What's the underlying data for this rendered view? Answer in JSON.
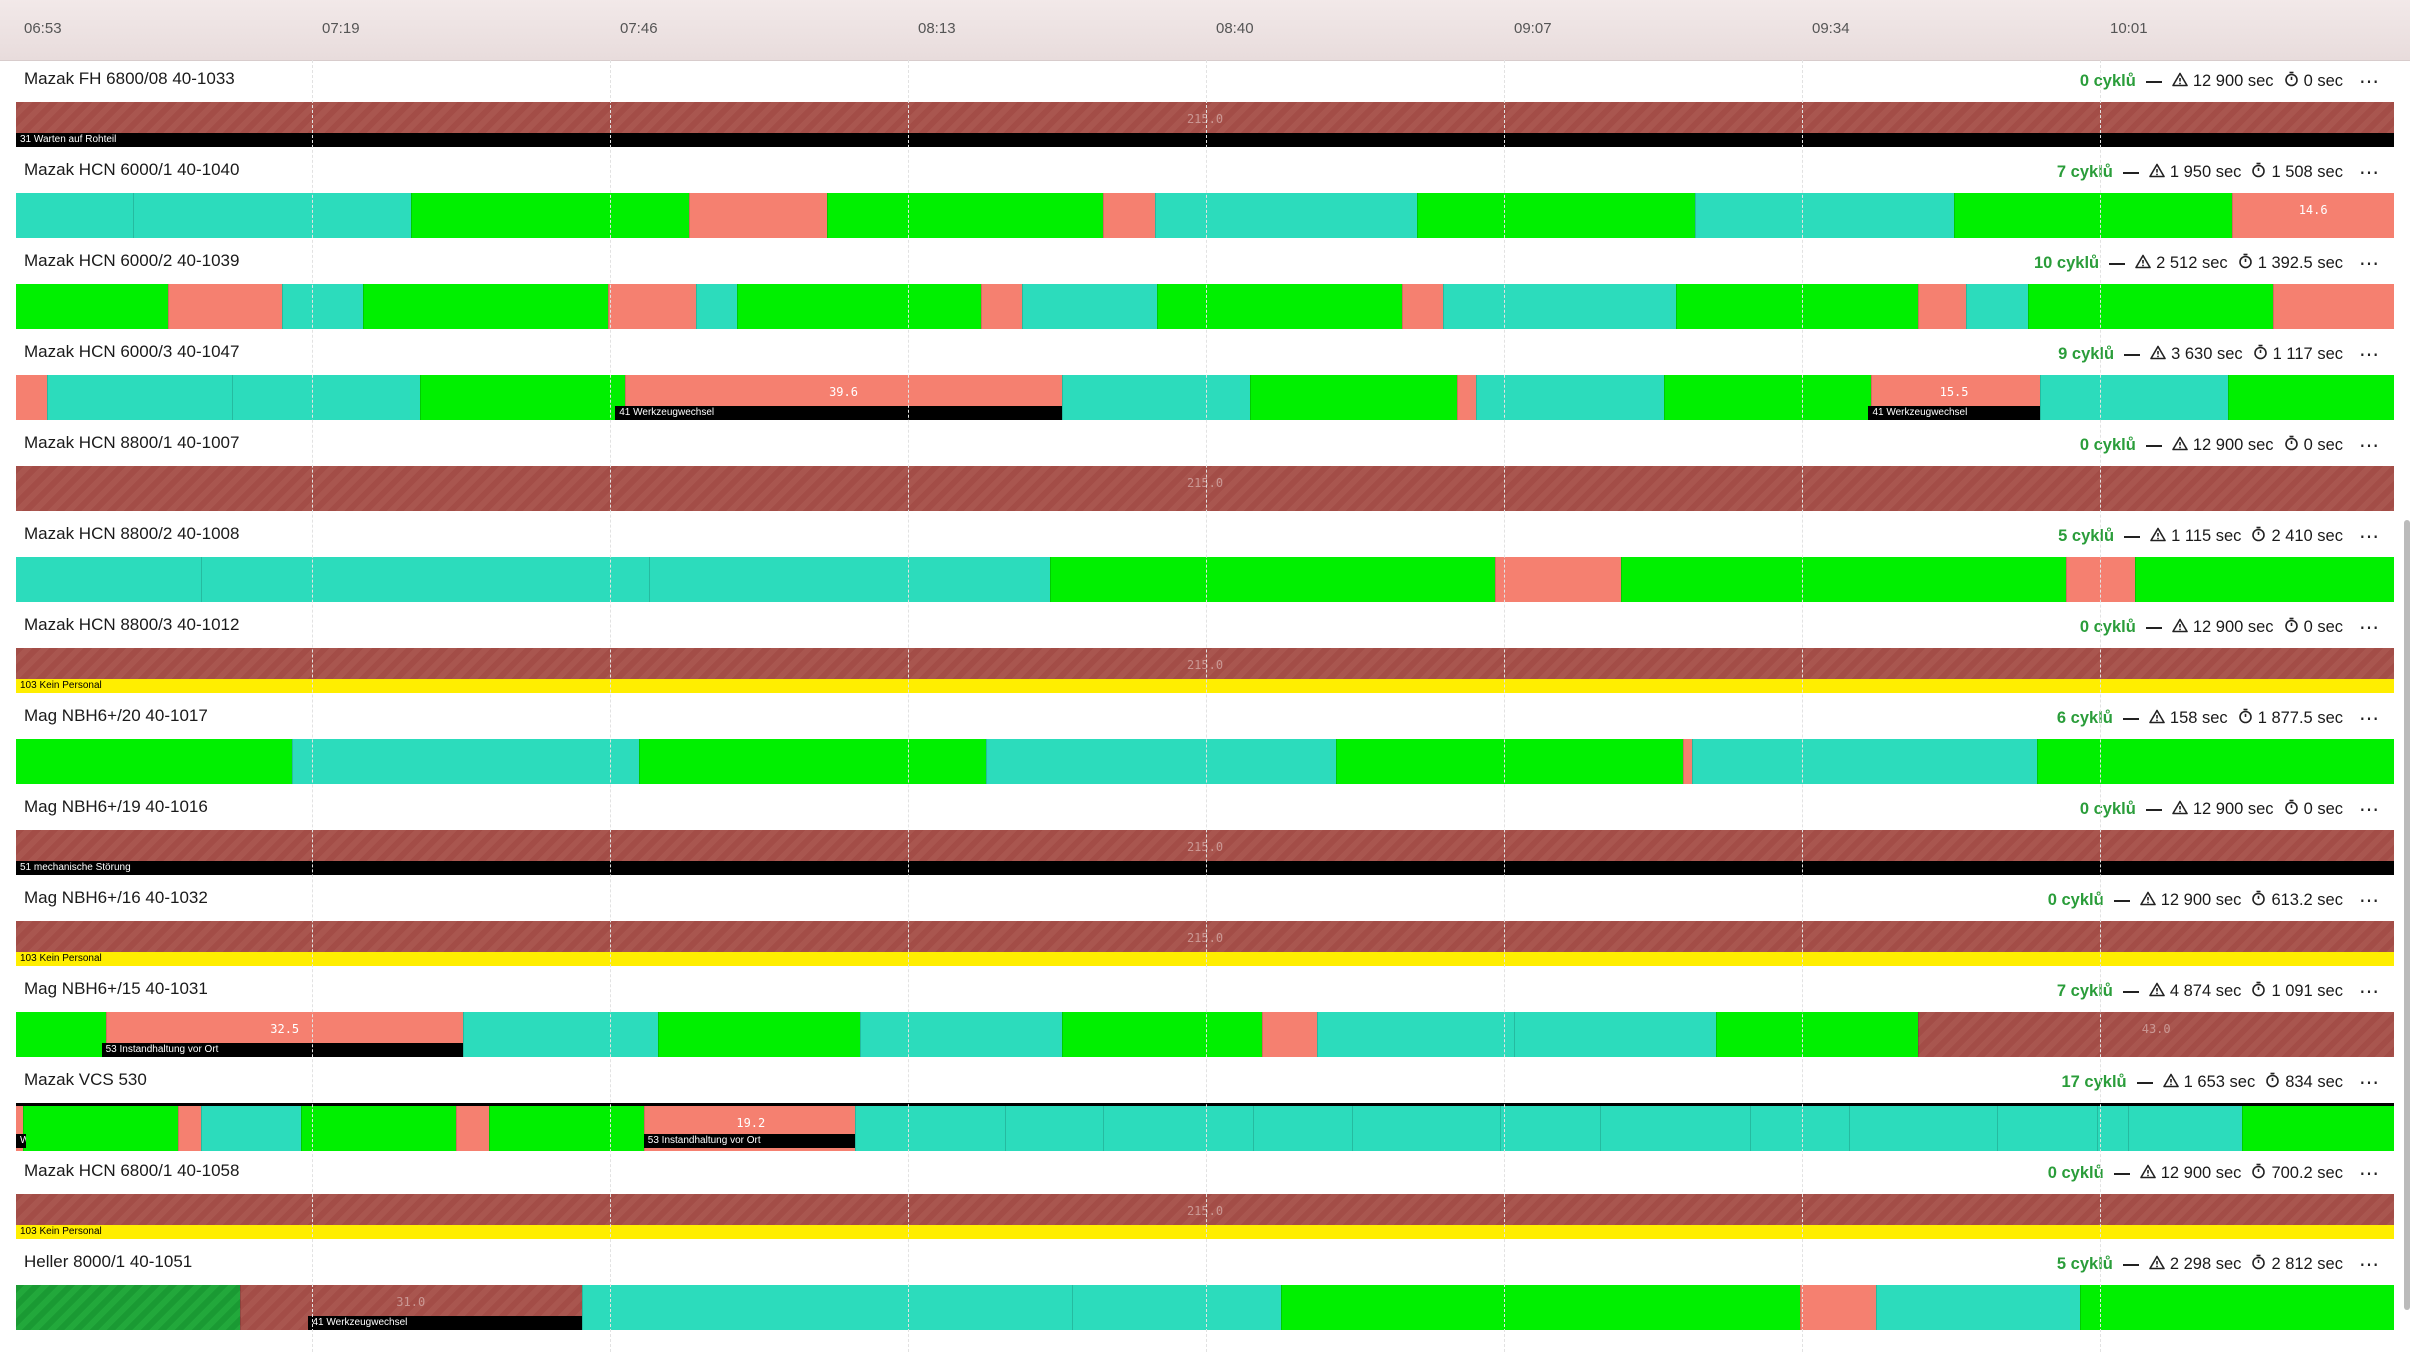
{
  "timeline": {
    "ticks": [
      "06:53",
      "07:19",
      "07:46",
      "08:13",
      "08:40",
      "09:07",
      "09:34",
      "10:01"
    ]
  },
  "rows": [
    {
      "title": "Mazak FH 6800/08 40-1033",
      "cycles": "0 cyklů",
      "warn": "12 900 sec",
      "time": "0 sec",
      "segments": [
        {
          "c": "brown",
          "s": 0,
          "e": 1
        }
      ],
      "values": [
        {
          "t": "215.0",
          "p": 0.5,
          "faint": true
        }
      ],
      "annotations": [
        {
          "t": "31 Warten auf Rohteil",
          "s": 0,
          "e": 1,
          "c": "black"
        }
      ]
    },
    {
      "title": "Mazak HCN 6000/1 40-1040",
      "cycles": "7 cyklů",
      "warn": "1 950 sec",
      "time": "1 508 sec",
      "segments": [
        {
          "c": "teal",
          "s": 0,
          "e": 0.049
        },
        {
          "c": "teal",
          "s": 0.049,
          "e": 0.166
        },
        {
          "c": "green",
          "s": 0.166,
          "e": 0.283
        },
        {
          "c": "salmon",
          "s": 0.283,
          "e": 0.341
        },
        {
          "c": "green",
          "s": 0.341,
          "e": 0.457
        },
        {
          "c": "salmon",
          "s": 0.457,
          "e": 0.479
        },
        {
          "c": "teal",
          "s": 0.479,
          "e": 0.589
        },
        {
          "c": "green",
          "s": 0.589,
          "e": 0.706
        },
        {
          "c": "teal",
          "s": 0.706,
          "e": 0.815
        },
        {
          "c": "green",
          "s": 0.815,
          "e": 0.932
        },
        {
          "c": "salmon",
          "s": 0.932,
          "e": 1
        }
      ],
      "values": [
        {
          "t": "14.6",
          "p": 0.966
        }
      ],
      "annotations": []
    },
    {
      "title": "Mazak HCN 6000/2 40-1039",
      "cycles": "10 cyklů",
      "warn": "2 512 sec",
      "time": "1 392.5 sec",
      "segments": [
        {
          "c": "green",
          "s": 0,
          "e": 0.064
        },
        {
          "c": "salmon",
          "s": 0.064,
          "e": 0.112
        },
        {
          "c": "teal",
          "s": 0.112,
          "e": 0.146
        },
        {
          "c": "green",
          "s": 0.146,
          "e": 0.249
        },
        {
          "c": "salmon",
          "s": 0.249,
          "e": 0.286
        },
        {
          "c": "teal",
          "s": 0.286,
          "e": 0.303
        },
        {
          "c": "green",
          "s": 0.303,
          "e": 0.406
        },
        {
          "c": "salmon",
          "s": 0.406,
          "e": 0.423
        },
        {
          "c": "teal",
          "s": 0.423,
          "e": 0.48
        },
        {
          "c": "green",
          "s": 0.48,
          "e": 0.583
        },
        {
          "c": "salmon",
          "s": 0.583,
          "e": 0.6
        },
        {
          "c": "teal",
          "s": 0.6,
          "e": 0.698
        },
        {
          "c": "green",
          "s": 0.698,
          "e": 0.8
        },
        {
          "c": "salmon",
          "s": 0.8,
          "e": 0.82
        },
        {
          "c": "teal",
          "s": 0.82,
          "e": 0.846
        },
        {
          "c": "green",
          "s": 0.846,
          "e": 0.949
        },
        {
          "c": "salmon",
          "s": 0.949,
          "e": 1
        }
      ],
      "values": [],
      "annotations": []
    },
    {
      "title": "Mazak HCN 6000/3 40-1047",
      "cycles": "9 cyklů",
      "warn": "3 630 sec",
      "time": "1 117 sec",
      "segments": [
        {
          "c": "salmon",
          "s": 0,
          "e": 0.013
        },
        {
          "c": "teal",
          "s": 0.013,
          "e": 0.091
        },
        {
          "c": "teal",
          "s": 0.091,
          "e": 0.17
        },
        {
          "c": "green",
          "s": 0.17,
          "e": 0.256
        },
        {
          "c": "salmon",
          "s": 0.256,
          "e": 0.44
        },
        {
          "c": "teal",
          "s": 0.44,
          "e": 0.519
        },
        {
          "c": "green",
          "s": 0.519,
          "e": 0.606
        },
        {
          "c": "salmon",
          "s": 0.606,
          "e": 0.614
        },
        {
          "c": "teal",
          "s": 0.614,
          "e": 0.693
        },
        {
          "c": "green",
          "s": 0.693,
          "e": 0.78
        },
        {
          "c": "salmon",
          "s": 0.78,
          "e": 0.851
        },
        {
          "c": "teal",
          "s": 0.851,
          "e": 0.93
        },
        {
          "c": "green",
          "s": 0.93,
          "e": 1
        }
      ],
      "values": [
        {
          "t": "39.6",
          "p": 0.348
        },
        {
          "t": "15.5",
          "p": 0.815
        }
      ],
      "annotations": [
        {
          "t": "41 Werkzeugwechsel",
          "s": 0.252,
          "e": 0.44,
          "c": "black"
        },
        {
          "t": "41 Werkzeugwechsel",
          "s": 0.779,
          "e": 0.851,
          "c": "black"
        }
      ]
    },
    {
      "title": "Mazak HCN 8800/1 40-1007",
      "cycles": "0 cyklů",
      "warn": "12 900 sec",
      "time": "0 sec",
      "segments": [
        {
          "c": "brown",
          "s": 0,
          "e": 1
        }
      ],
      "values": [
        {
          "t": "215.0",
          "p": 0.5,
          "faint": true
        }
      ],
      "annotations": []
    },
    {
      "title": "Mazak HCN 8800/2 40-1008",
      "cycles": "5 cyklů",
      "warn": "1 115 sec",
      "time": "2 410 sec",
      "segments": [
        {
          "c": "teal",
          "s": 0,
          "e": 0.078
        },
        {
          "c": "teal",
          "s": 0.078,
          "e": 0.266
        },
        {
          "c": "teal",
          "s": 0.266,
          "e": 0.435
        },
        {
          "c": "green",
          "s": 0.435,
          "e": 0.622
        },
        {
          "c": "salmon",
          "s": 0.622,
          "e": 0.675
        },
        {
          "c": "green",
          "s": 0.675,
          "e": 0.862
        },
        {
          "c": "salmon",
          "s": 0.862,
          "e": 0.891
        },
        {
          "c": "green",
          "s": 0.891,
          "e": 1
        }
      ],
      "values": [],
      "annotations": []
    },
    {
      "title": "Mazak HCN 8800/3 40-1012",
      "cycles": "0 cyklů",
      "warn": "12 900 sec",
      "time": "0 sec",
      "segments": [
        {
          "c": "brown",
          "s": 0,
          "e": 1
        }
      ],
      "values": [
        {
          "t": "215.0",
          "p": 0.5,
          "faint": true
        }
      ],
      "annotations": [
        {
          "t": "103 Kein Personal",
          "s": 0,
          "e": 1,
          "c": "yellow"
        }
      ]
    },
    {
      "title": "Mag NBH6+/20 40-1017",
      "cycles": "6 cyklů",
      "warn": "158 sec",
      "time": "1 877.5 sec",
      "segments": [
        {
          "c": "green",
          "s": 0,
          "e": 0.116
        },
        {
          "c": "teal",
          "s": 0.116,
          "e": 0.262
        },
        {
          "c": "green",
          "s": 0.262,
          "e": 0.408
        },
        {
          "c": "teal",
          "s": 0.408,
          "e": 0.555
        },
        {
          "c": "green",
          "s": 0.555,
          "e": 0.701
        },
        {
          "c": "salmon",
          "s": 0.701,
          "e": 0.705
        },
        {
          "c": "teal",
          "s": 0.705,
          "e": 0.85
        },
        {
          "c": "green",
          "s": 0.85,
          "e": 1
        }
      ],
      "values": [],
      "annotations": []
    },
    {
      "title": "Mag NBH6+/19 40-1016",
      "cycles": "0 cyklů",
      "warn": "12 900 sec",
      "time": "0 sec",
      "segments": [
        {
          "c": "brown",
          "s": 0,
          "e": 1
        }
      ],
      "values": [
        {
          "t": "215.0",
          "p": 0.5,
          "faint": true
        }
      ],
      "annotations": [
        {
          "t": "51 mechanische Störung",
          "s": 0,
          "e": 1,
          "c": "black"
        }
      ]
    },
    {
      "title": "Mag NBH6+/16 40-1032",
      "cycles": "0 cyklů",
      "warn": "12 900 sec",
      "time": "613.2 sec",
      "segments": [
        {
          "c": "brown",
          "s": 0,
          "e": 1
        }
      ],
      "values": [
        {
          "t": "215.0",
          "p": 0.5,
          "faint": true
        }
      ],
      "annotations": [
        {
          "t": "103 Kein Personal",
          "s": 0,
          "e": 1,
          "c": "yellow"
        }
      ]
    },
    {
      "title": "Mag NBH6+/15 40-1031",
      "cycles": "7 cyklů",
      "warn": "4 874 sec",
      "time": "1 091 sec",
      "segments": [
        {
          "c": "green",
          "s": 0,
          "e": 0.038
        },
        {
          "c": "salmon",
          "s": 0.038,
          "e": 0.188
        },
        {
          "c": "teal",
          "s": 0.188,
          "e": 0.27
        },
        {
          "c": "green",
          "s": 0.27,
          "e": 0.355
        },
        {
          "c": "teal",
          "s": 0.355,
          "e": 0.44
        },
        {
          "c": "green",
          "s": 0.44,
          "e": 0.524
        },
        {
          "c": "salmon",
          "s": 0.524,
          "e": 0.547
        },
        {
          "c": "teal",
          "s": 0.547,
          "e": 0.63
        },
        {
          "c": "teal",
          "s": 0.63,
          "e": 0.715
        },
        {
          "c": "green",
          "s": 0.715,
          "e": 0.8
        },
        {
          "c": "brown",
          "s": 0.8,
          "e": 1
        }
      ],
      "values": [
        {
          "t": "32.5",
          "p": 0.113
        },
        {
          "t": "43.0",
          "p": 0.9,
          "faint": true
        }
      ],
      "annotations": [
        {
          "t": "53 Instandhaltung vor Ort",
          "s": 0.036,
          "e": 0.188,
          "c": "black"
        }
      ]
    },
    {
      "title": "Mazak VCS 530",
      "cycles": "17 cyklů",
      "warn": "1 653 sec",
      "time": "834 sec",
      "segments": [
        {
          "c": "salmon",
          "s": 0,
          "e": 0.003
        },
        {
          "c": "green",
          "s": 0.003,
          "e": 0.068
        },
        {
          "c": "salmon",
          "s": 0.068,
          "e": 0.078
        },
        {
          "c": "teal",
          "s": 0.078,
          "e": 0.12
        },
        {
          "c": "green",
          "s": 0.12,
          "e": 0.185
        },
        {
          "c": "salmon",
          "s": 0.185,
          "e": 0.199
        },
        {
          "c": "green",
          "s": 0.199,
          "e": 0.264
        },
        {
          "c": "salmon",
          "s": 0.264,
          "e": 0.353
        },
        {
          "c": "teal",
          "s": 0.353,
          "e": 0.416
        },
        {
          "c": "teal",
          "s": 0.416,
          "e": 0.457
        },
        {
          "c": "teal",
          "s": 0.457,
          "e": 0.52
        },
        {
          "c": "teal",
          "s": 0.52,
          "e": 0.562
        },
        {
          "c": "teal",
          "s": 0.562,
          "e": 0.624
        },
        {
          "c": "teal",
          "s": 0.624,
          "e": 0.666
        },
        {
          "c": "teal",
          "s": 0.666,
          "e": 0.729
        },
        {
          "c": "teal",
          "s": 0.729,
          "e": 0.771
        },
        {
          "c": "teal",
          "s": 0.771,
          "e": 0.833
        },
        {
          "c": "teal",
          "s": 0.833,
          "e": 0.875
        },
        {
          "c": "teal",
          "s": 0.875,
          "e": 0.888
        },
        {
          "c": "teal",
          "s": 0.888,
          "e": 0.936
        },
        {
          "c": "green",
          "s": 0.936,
          "e": 1
        }
      ],
      "values": [
        {
          "t": "19.2",
          "p": 0.309
        }
      ],
      "annotations": [
        {
          "t": "W",
          "s": 0,
          "e": 0.004,
          "c": "black"
        },
        {
          "t": "53 Instandhaltung vor Ort",
          "s": 0.264,
          "e": 0.353,
          "c": "black"
        }
      ],
      "topline": true
    },
    {
      "title": "Mazak HCN 6800/1 40-1058",
      "cycles": "0 cyklů",
      "warn": "12 900 sec",
      "time": "700.2 sec",
      "segments": [
        {
          "c": "brown",
          "s": 0,
          "e": 1
        }
      ],
      "values": [
        {
          "t": "215.0",
          "p": 0.5,
          "faint": true
        }
      ],
      "annotations": [
        {
          "t": "103 Kein Personal",
          "s": 0,
          "e": 1,
          "c": "yellow"
        }
      ]
    },
    {
      "title": "Heller 8000/1 40-1051",
      "cycles": "5 cyklů",
      "warn": "2 298 sec",
      "time": "2 812 sec",
      "segments": [
        {
          "c": "darkgreen",
          "s": 0,
          "e": 0.094
        },
        {
          "c": "brown",
          "s": 0.094,
          "e": 0.238
        },
        {
          "c": "teal",
          "s": 0.238,
          "e": 0.444
        },
        {
          "c": "teal",
          "s": 0.444,
          "e": 0.532
        },
        {
          "c": "green",
          "s": 0.532,
          "e": 0.75
        },
        {
          "c": "salmon",
          "s": 0.75,
          "e": 0.782
        },
        {
          "c": "teal",
          "s": 0.782,
          "e": 0.868
        },
        {
          "c": "green",
          "s": 0.868,
          "e": 1
        }
      ],
      "values": [
        {
          "t": "31.0",
          "p": 0.166,
          "faint": true
        }
      ],
      "annotations": [
        {
          "t": "41 Werkzeugwechsel",
          "s": 0.123,
          "e": 0.238,
          "c": "black"
        }
      ]
    }
  ],
  "icons": {
    "warn": "warning-triangle-icon",
    "time": "stopwatch-icon",
    "menu": "more-horizontal-icon"
  },
  "colors": {
    "running": "#00f000",
    "setup": "#2cdcbc",
    "stop": "#f58070",
    "idle": "#a34d47",
    "cycles": "#2a9d3a"
  }
}
